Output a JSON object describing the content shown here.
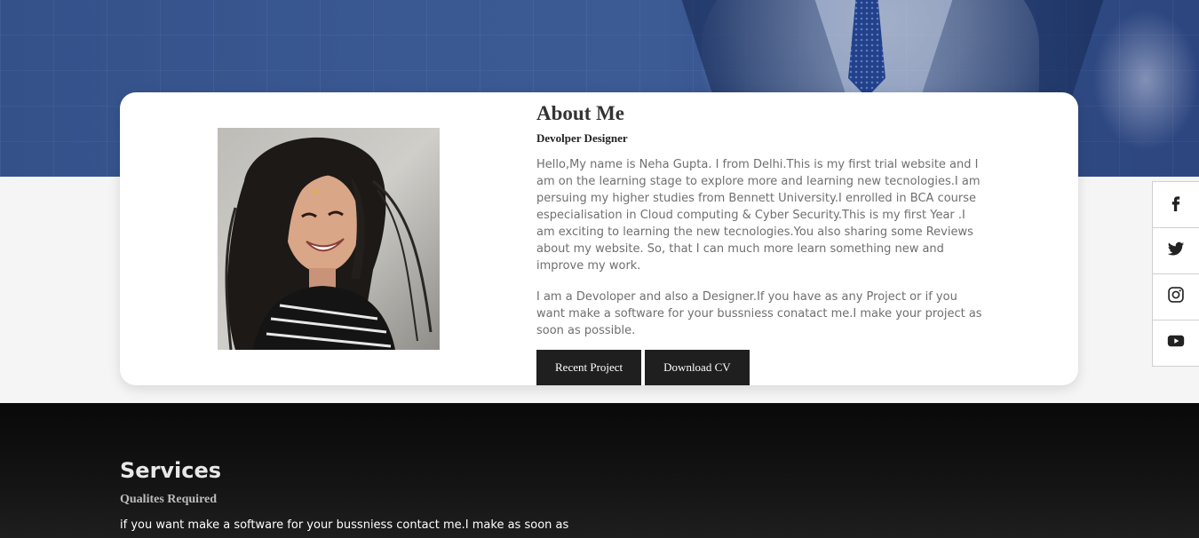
{
  "about": {
    "title": "About Me",
    "subtitle": "Devolper Designer",
    "paragraph1": "Hello,My name is Neha Gupta. I from Delhi.This is my first trial website and I am on the learning stage to explore more and learning new tecnologies.I am persuing my higher studies from Bennett University.I enrolled in BCA course especialisation in Cloud computing & Cyber Security.This is my first Year .I am exciting to learning the new tecnologies.You also sharing some Reviews about my website. So, that I can much more learn something new and improve my work.",
    "paragraph2": "I am a Devoloper and also a Designer.If you have as any Project or if you want make a software for your bussniess conatact me.I make your project as soon as possible.",
    "recent_project_label": "Recent Project",
    "download_cv_label": "Download CV"
  },
  "social": {
    "items": [
      {
        "name": "facebook-icon"
      },
      {
        "name": "twitter-icon"
      },
      {
        "name": "instagram-icon"
      },
      {
        "name": "youtube-icon"
      }
    ]
  },
  "services": {
    "title": "Services",
    "subtitle": "Qualites Required",
    "text": "if you want make a software for your bussniess contact me.I make as soon as"
  },
  "colors": {
    "hero": "#3a5892",
    "button": "#1f1f1f",
    "card": "#ffffff",
    "services_bg": "#0f0f0f"
  }
}
